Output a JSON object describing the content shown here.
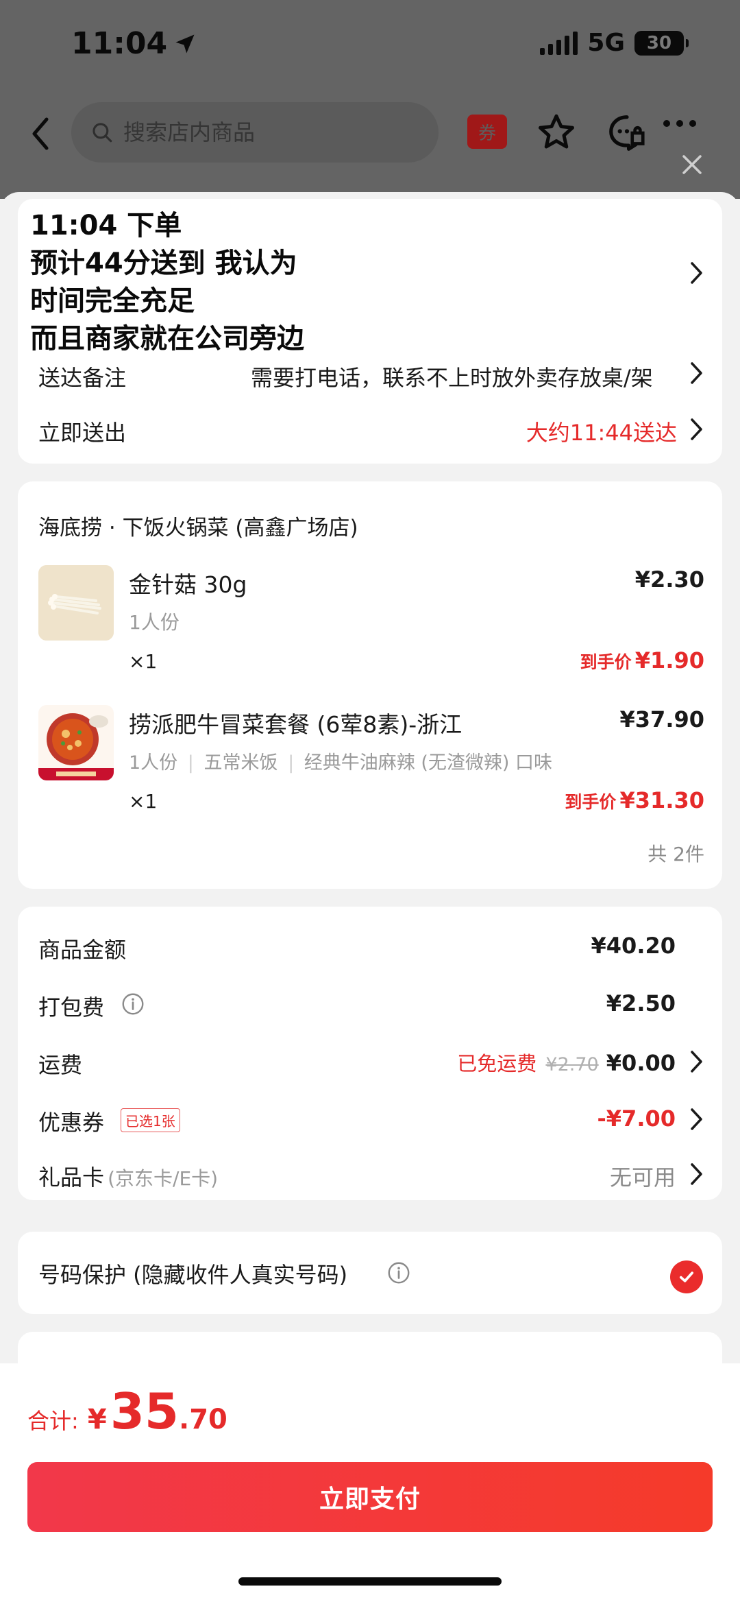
{
  "status_bar": {
    "time": "11:04",
    "network": "5G",
    "battery": "30"
  },
  "nav": {
    "search_placeholder": "搜索店内商品",
    "coupon_label": "券"
  },
  "overlay_caption": {
    "lines": [
      "11:04 下单",
      "预计44分送到 我认为",
      "时间完全充足",
      "而且商家就在公司旁边"
    ]
  },
  "delivery": {
    "note_label": "送达备注",
    "note_value": "需要打电话，联系不上时放外卖存放桌/架",
    "time_label": "立即送出",
    "time_value": "大约11:44送达"
  },
  "store": {
    "name": "海底捞 · 下饭火锅菜 (高鑫广场店)",
    "items": [
      {
        "name": "金针菇 30g",
        "spec": "1人份",
        "qty": "×1",
        "price": "¥2.30",
        "final_label": "到手价",
        "final_price": "¥1.90"
      },
      {
        "name": "捞派肥牛冒菜套餐 (6荤8素)-浙江",
        "spec": "1人份",
        "spec2": "五常米饭",
        "spec3": "经典牛油麻辣 (无渣微辣) 口味",
        "qty": "×1",
        "price": "¥37.90",
        "final_label": "到手价",
        "final_price": "¥31.30"
      }
    ],
    "total_count": "共 2件"
  },
  "fees": {
    "goods_label": "商品金额",
    "goods_value": "¥40.20",
    "pack_label": "打包费",
    "pack_value": "¥2.50",
    "ship_label": "运费",
    "ship_free": "已免运费",
    "ship_original": "¥2.70",
    "ship_value": "¥0.00",
    "coupon_label": "优惠券",
    "coupon_badge": "已选1张",
    "coupon_value": "-¥7.00",
    "gift_label": "礼品卡",
    "gift_sub": "(京东卡/E卡)",
    "gift_value": "无可用"
  },
  "privacy": {
    "label": "号码保护 (隐藏收件人真实号码)"
  },
  "total": {
    "label": "合计:",
    "currency": "¥",
    "integer": "35",
    "decimal": ".70",
    "pay_button": "立即支付"
  },
  "colors": {
    "accent": "#e52a2a",
    "pay_gradient_start": "#f2384a",
    "pay_gradient_end": "#f53a2a"
  }
}
